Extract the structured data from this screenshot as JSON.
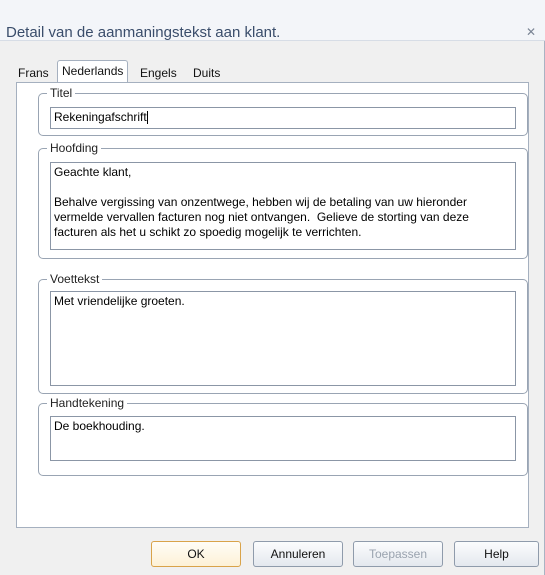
{
  "window": {
    "title": "Detail van de aanmaningstekst aan klant.",
    "close_icon": "close-icon"
  },
  "tabs": [
    {
      "label": "Frans",
      "active": false
    },
    {
      "label": "Nederlands",
      "active": true
    },
    {
      "label": "Engels",
      "active": false
    },
    {
      "label": "Duits",
      "active": false
    }
  ],
  "groups": {
    "titel": {
      "label": "Titel",
      "value": "Rekeningafschrift"
    },
    "hoofding": {
      "label": "Hoofding",
      "value": "Geachte klant,\n\nBehalve vergissing van onzentwege, hebben wij de betaling van uw hieronder vermelde vervallen facturen nog niet ontvangen.  Gelieve de storting van deze facturen als het u schikt zo spoedig mogelijk te verrichten."
    },
    "voettekst": {
      "label": "Voettekst",
      "value": "Met vriendelijke groeten."
    },
    "handtekening": {
      "label": "Handtekening",
      "value": "De boekhouding."
    }
  },
  "buttons": {
    "ok": "OK",
    "cancel": "Annuleren",
    "apply": "Toepassen",
    "help": "Help"
  }
}
